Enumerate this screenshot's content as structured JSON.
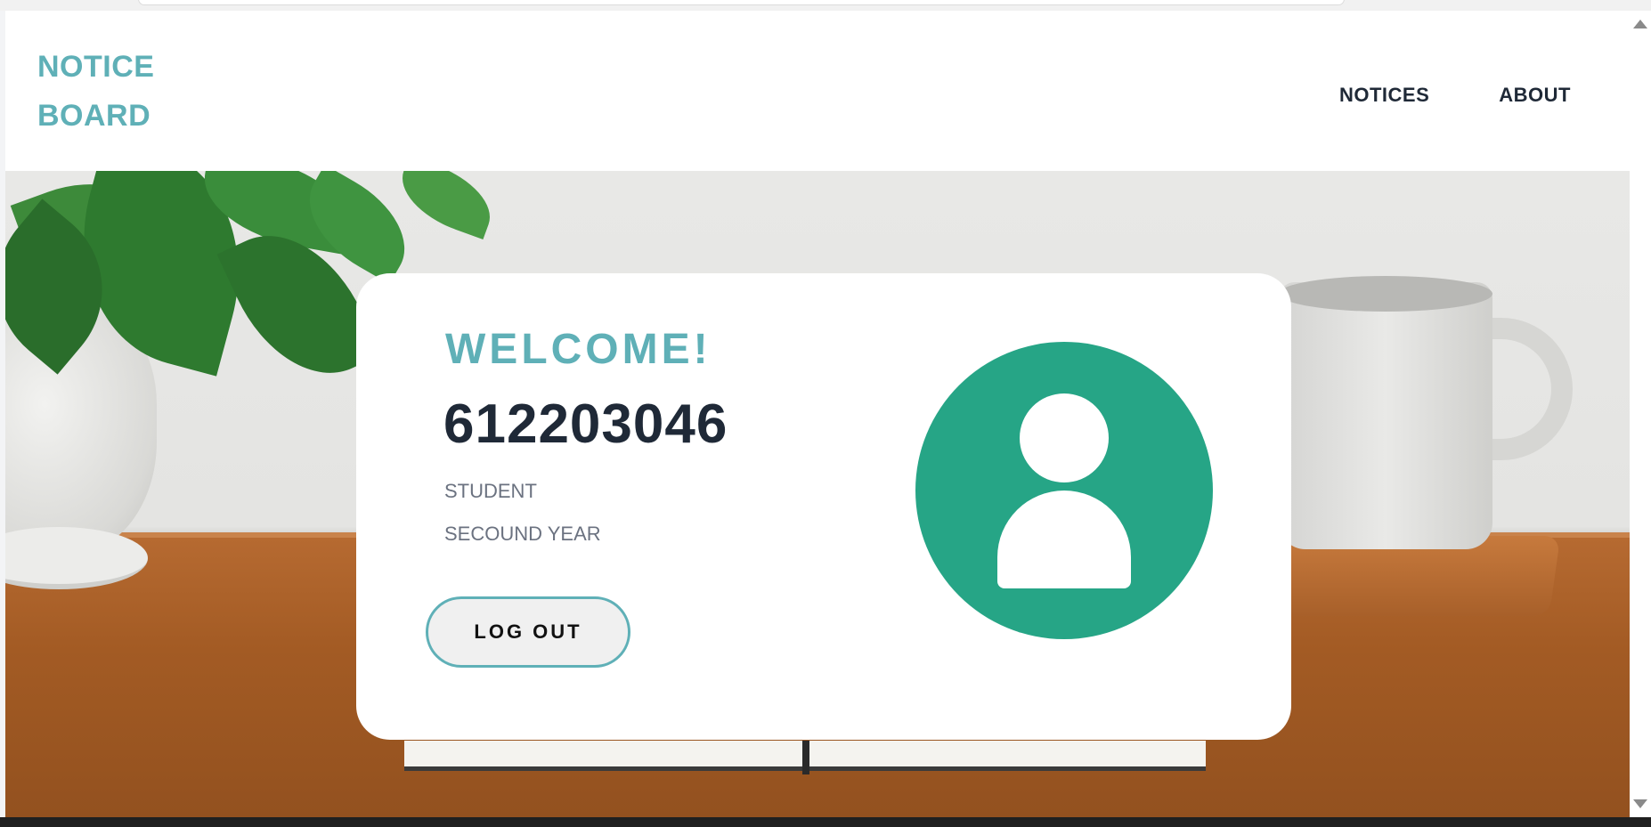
{
  "brand": {
    "line1": "NOTICE",
    "line2": "BOARD"
  },
  "nav": {
    "items": [
      {
        "label": "NOTICES"
      },
      {
        "label": "ABOUT"
      }
    ]
  },
  "profile": {
    "greeting": "WELCOME!",
    "user_id": "612203046",
    "role": "STUDENT",
    "year": "SECOUND YEAR",
    "logout_label": "LOG OUT",
    "avatar_icon": "user-icon"
  },
  "colors": {
    "brand_teal": "#5fb0b7",
    "avatar_green": "#26a586",
    "text_dark": "#1f2937",
    "text_muted": "#6b7280"
  }
}
